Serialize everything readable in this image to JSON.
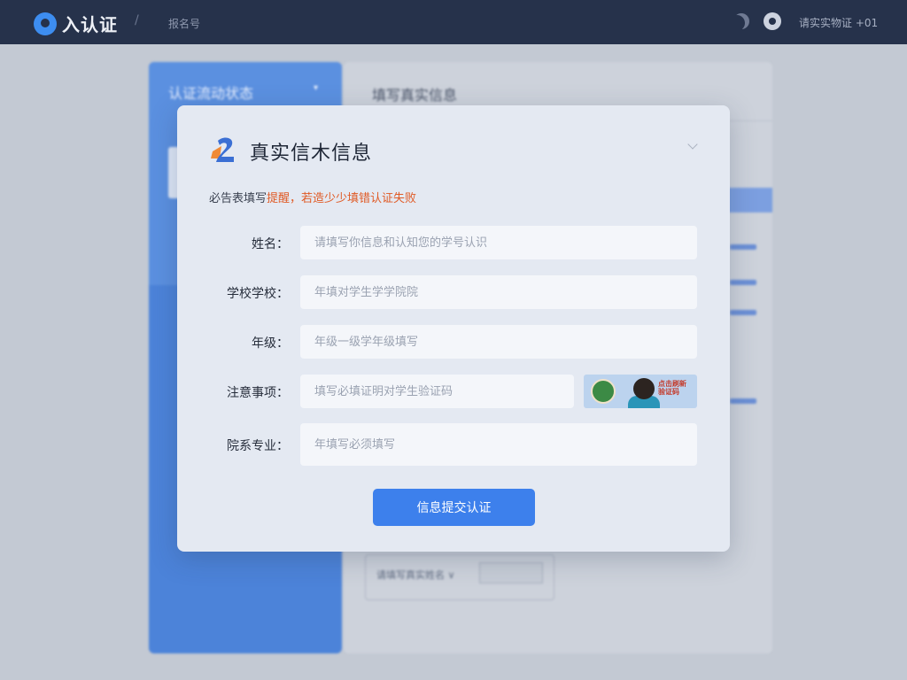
{
  "topbar": {
    "brand_title": "入认证",
    "separator": "/",
    "breadcrumb": "报名号",
    "user_text": "请实实物证 +01"
  },
  "background": {
    "sidebar_title": "认证流动状态",
    "sidebar_caret": "▾",
    "main_title": "填写真实信息",
    "bottom_box_label": "请填写真实姓名 ∨"
  },
  "modal": {
    "title": "真实信木信息",
    "notice_prefix": "必告表填写",
    "notice_accent": "提醒，",
    "notice_suffix": "若造少少填错认证失败",
    "fields": [
      {
        "label": "姓名：",
        "placeholder": "请填写你信息和认知您的学号认识"
      },
      {
        "label": "学校学校：",
        "placeholder": "年填对学生学学院院"
      },
      {
        "label": "年级：",
        "placeholder": "年级一级学年级填写"
      },
      {
        "label": "注意事项：",
        "placeholder": "填写必填证明对学生验证码"
      },
      {
        "label": "院系专业：",
        "placeholder": "年填写必须填写"
      }
    ],
    "captcha_text": "点击刷新验证码",
    "submit_label": "信息提交认证"
  },
  "colors": {
    "topbar": "#26324b",
    "accent": "#3d80ec",
    "warning": "#e05a25",
    "modal_bg": "#e4e9f2"
  }
}
